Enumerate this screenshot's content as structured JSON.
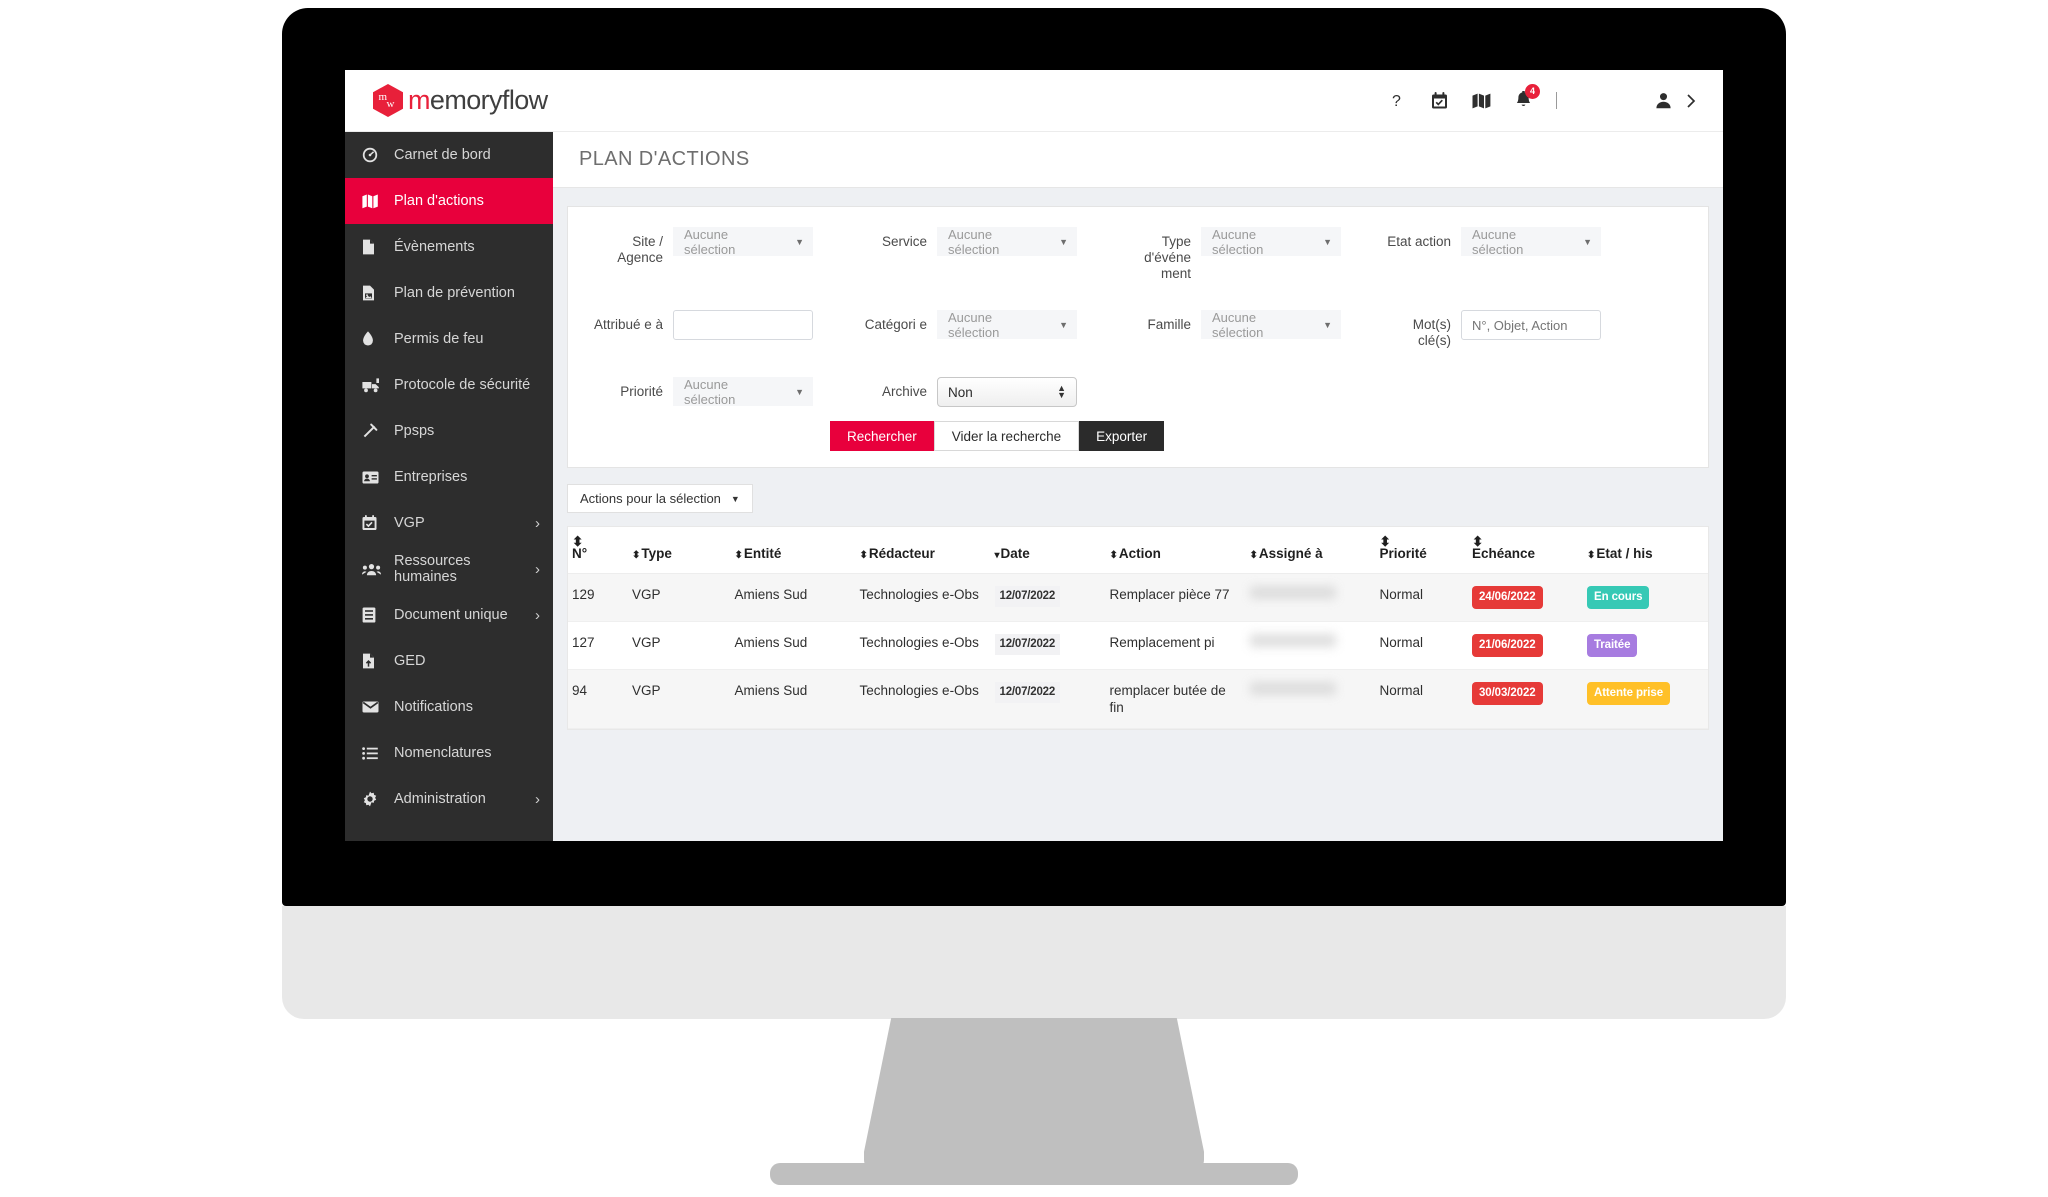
{
  "brand": {
    "mark_top": "m",
    "mark_bottom": "w",
    "name_accent": "m",
    "name_rest": "emoryflow"
  },
  "topbar": {
    "help_icon": "question-mark-icon",
    "calendar_icon": "calendar-check-icon",
    "map_icon": "map-icon",
    "bell_icon": "bell-icon",
    "bell_badge": "4",
    "user_icon": "user-icon",
    "expand_icon": "chevron-right-icon"
  },
  "sidebar": {
    "items": [
      {
        "label": "Carnet de bord",
        "icon": "dashboard-icon",
        "active": false,
        "chevron": false
      },
      {
        "label": "Plan d'actions",
        "icon": "map-icon",
        "active": true,
        "chevron": false
      },
      {
        "label": "Évènements",
        "icon": "document-icon",
        "active": false,
        "chevron": false
      },
      {
        "label": "Plan de prévention",
        "icon": "document-image-icon",
        "active": false,
        "chevron": false
      },
      {
        "label": "Permis de feu",
        "icon": "flame-icon",
        "active": false,
        "chevron": false
      },
      {
        "label": "Protocole de sécurité",
        "icon": "truck-icon",
        "active": false,
        "chevron": false
      },
      {
        "label": "Ppsps",
        "icon": "hammer-icon",
        "active": false,
        "chevron": false
      },
      {
        "label": "Entreprises",
        "icon": "id-card-icon",
        "active": false,
        "chevron": false
      },
      {
        "label": "VGP",
        "icon": "calendar-check-icon",
        "active": false,
        "chevron": true
      },
      {
        "label": "Ressources humaines",
        "icon": "users-icon",
        "active": false,
        "chevron": true
      },
      {
        "label": "Document unique",
        "icon": "book-icon",
        "active": false,
        "chevron": true
      },
      {
        "label": "GED",
        "icon": "file-upload-icon",
        "active": false,
        "chevron": false
      },
      {
        "label": "Notifications",
        "icon": "envelope-icon",
        "active": false,
        "chevron": false
      },
      {
        "label": "Nomenclatures",
        "icon": "list-icon",
        "active": false,
        "chevron": false
      },
      {
        "label": "Administration",
        "icon": "gear-icon",
        "active": false,
        "chevron": true
      }
    ]
  },
  "page": {
    "title": "PLAN D'ACTIONS"
  },
  "filters": {
    "no_selection": "Aucune sélection",
    "site_label": "Site / Agence",
    "site_value": "Aucune sélection",
    "service_label": "Service",
    "service_value": "Aucune sélection",
    "type_label": "Type d'événe ment",
    "type_value": "Aucune sélection",
    "etat_label": "Etat action",
    "etat_value": "Aucune sélection",
    "attribue_label": "Attribué e à",
    "attribue_value": "",
    "categorie_label": "Catégori e",
    "categorie_value": "Aucune sélection",
    "famille_label": "Famille",
    "famille_value": "Aucune sélection",
    "motscles_label": "Mot(s) clé(s)",
    "motscles_placeholder": "N°, Objet, Action",
    "priorite_label": "Priorité",
    "priorite_value": "Aucune sélection",
    "archive_label": "Archive",
    "archive_value": "Non",
    "btn_search": "Rechercher",
    "btn_clear": "Vider la recherche",
    "btn_export": "Exporter"
  },
  "toolbar": {
    "bulk_actions": "Actions pour la sélection"
  },
  "table": {
    "columns": [
      {
        "label": "N°",
        "sortable": true,
        "sort_state": "both"
      },
      {
        "label": "Type",
        "sortable": true,
        "sort_state": "both"
      },
      {
        "label": "Entité",
        "sortable": true,
        "sort_state": "both"
      },
      {
        "label": "Rédacteur",
        "sortable": true,
        "sort_state": "both"
      },
      {
        "label": "Date",
        "sortable": true,
        "sort_state": "desc"
      },
      {
        "label": "Action",
        "sortable": true,
        "sort_state": "both"
      },
      {
        "label": "Assigné à",
        "sortable": true,
        "sort_state": "both"
      },
      {
        "label": "Priorité",
        "sortable": true,
        "sort_state": "both"
      },
      {
        "label": "Echéance",
        "sortable": true,
        "sort_state": "both"
      },
      {
        "label": "Etat / his",
        "sortable": true,
        "sort_state": "both"
      }
    ],
    "rows": [
      {
        "num": "129",
        "type": "VGP",
        "entite": "Amiens Sud",
        "redacteur": "Technologies e-Obs",
        "date": "12/07/2022",
        "action": "Remplacer pièce 77",
        "assigne": "",
        "priorite": "Normal",
        "echeance": "24/06/2022",
        "etat": "En cours",
        "etat_color": "#36c9b5"
      },
      {
        "num": "127",
        "type": "VGP",
        "entite": "Amiens Sud",
        "redacteur": "Technologies e-Obs",
        "date": "12/07/2022",
        "action": "Remplacement pi",
        "assigne": "",
        "priorite": "Normal",
        "echeance": "21/06/2022",
        "etat": "Traitée",
        "etat_color": "#a77ce0"
      },
      {
        "num": "94",
        "type": "VGP",
        "entite": "Amiens Sud",
        "redacteur": "Technologies e-Obs",
        "date": "12/07/2022",
        "action": "remplacer butée de fin",
        "assigne": "",
        "priorite": "Normal",
        "echeance": "30/03/2022",
        "etat": "Attente prise",
        "etat_color": "#ffc028"
      }
    ]
  },
  "colors": {
    "brand_red": "#e8003c",
    "sidebar_bg": "#2d2d2d",
    "badge_red": "#e63a38",
    "badge_teal": "#36c9b5",
    "badge_purple": "#a77ce0",
    "badge_orange": "#ffc028"
  }
}
